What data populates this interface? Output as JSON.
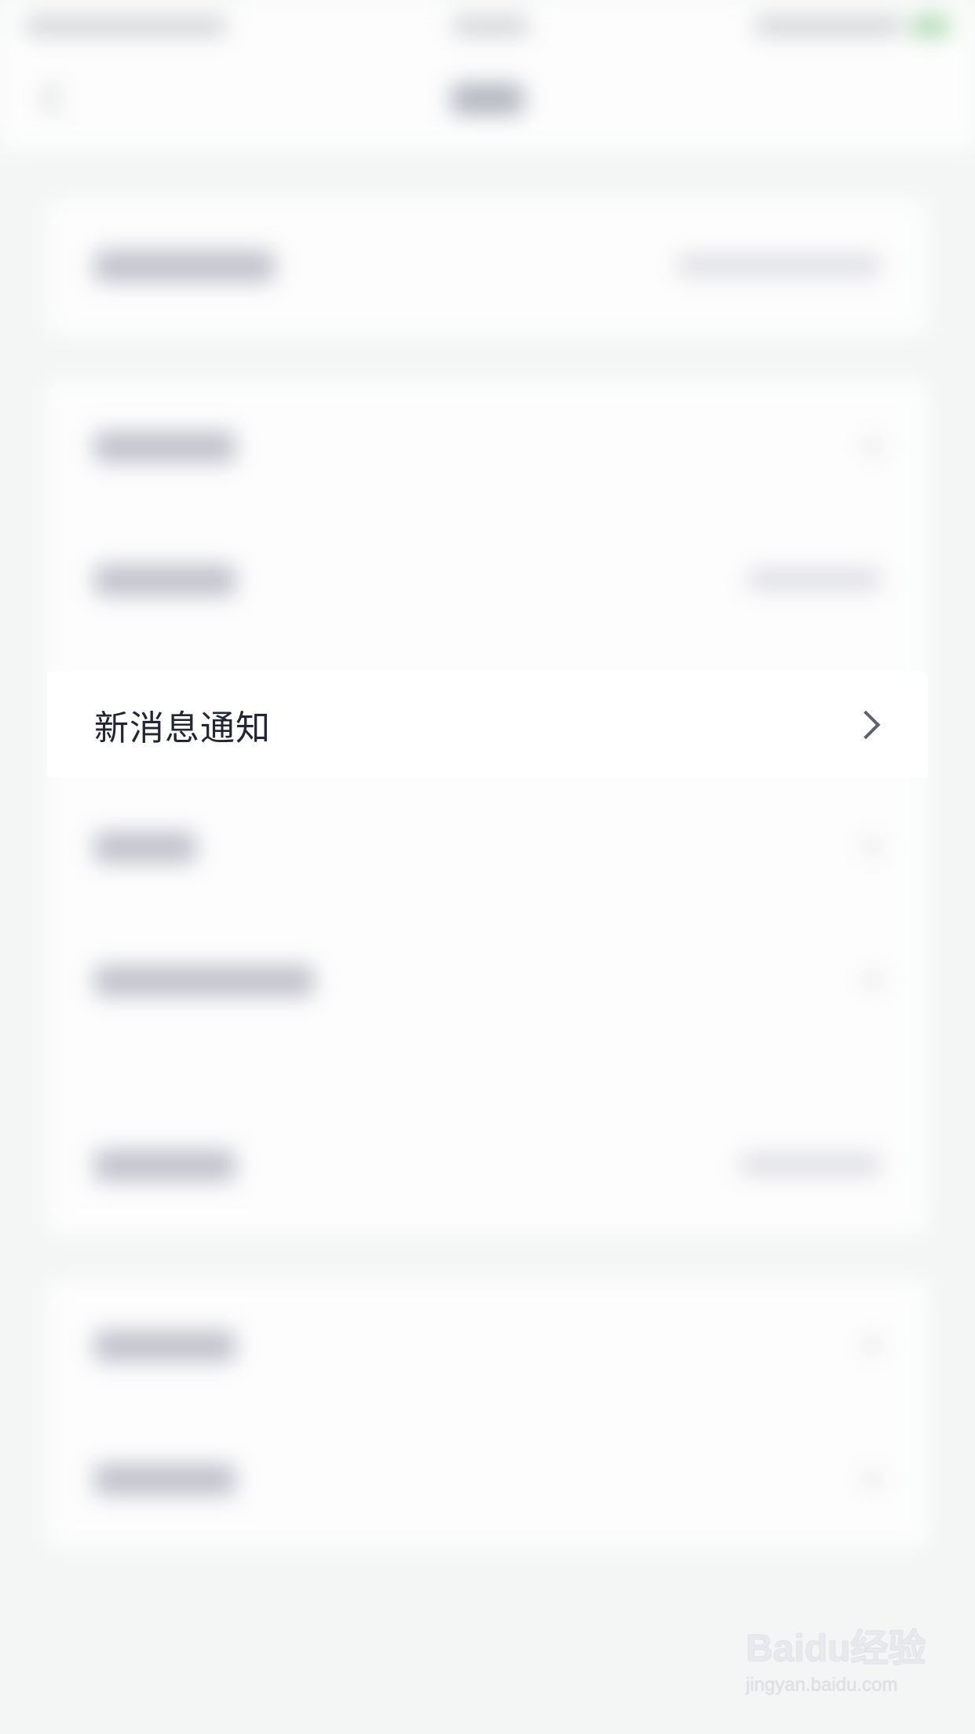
{
  "focused_row": {
    "label": "新消息通知",
    "icon": "chevron-right-icon"
  },
  "watermark": {
    "logo_text": "Baidu经验",
    "url": "jingyan.baidu.com"
  },
  "colors": {
    "background": "#f4f5f5",
    "row_background": "#ffffff",
    "label_text": "#222533",
    "chevron": "#5f6170",
    "battery": "#9fd3a3"
  }
}
